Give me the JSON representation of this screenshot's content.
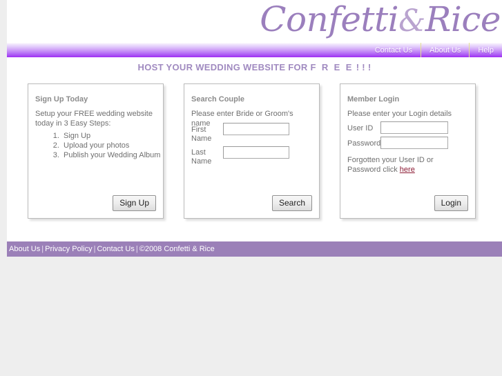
{
  "brand": {
    "logo_part1": "Confetti",
    "logo_amp": "&",
    "logo_part2": "Rice",
    "accent_purple": "#9f2df3",
    "logo_purple": "#9f86c0",
    "footer_purple": "#9b80b8",
    "heading_purple": "#a08ac0",
    "link_maroon": "#8b1a33"
  },
  "nav": {
    "items": [
      {
        "label": "Contact Us"
      },
      {
        "label": "About Us"
      },
      {
        "label": "Help"
      }
    ]
  },
  "headline": {
    "lead": "HOST YOUR WEDDING WEBSITE FOR ",
    "free": "F R E E",
    "bangs": " ! ! !"
  },
  "panels": {
    "signup": {
      "title": "Sign Up Today",
      "subtitle": "Setup your FREE wedding website today in 3 Easy Steps:",
      "steps": [
        "Sign Up",
        "Upload your photos",
        "Publish your Wedding Album"
      ],
      "button_label": "Sign Up"
    },
    "search": {
      "title": "Search Couple",
      "subtitle": "Please enter Bride or Groom's name",
      "first_name_label": "First Name",
      "first_name_value": "",
      "first_name_placeholder": "",
      "last_name_label": "Last Name",
      "last_name_value": "",
      "last_name_placeholder": "",
      "button_label": "Search"
    },
    "login": {
      "title": "Member Login",
      "subtitle": "Please enter your Login details",
      "userid_label": "User ID",
      "userid_value": "",
      "userid_placeholder": "",
      "password_label": "Password",
      "password_value": "",
      "password_placeholder": "",
      "forgot_text": "Forgotten your User ID or Password click ",
      "forgot_link_label": "here",
      "button_label": "Login"
    }
  },
  "footer": {
    "links": [
      {
        "label": "About Us"
      },
      {
        "label": "Privacy Policy"
      },
      {
        "label": "Contact Us"
      }
    ],
    "separator": "|",
    "copyright": "©2008 Confetti & Rice"
  }
}
